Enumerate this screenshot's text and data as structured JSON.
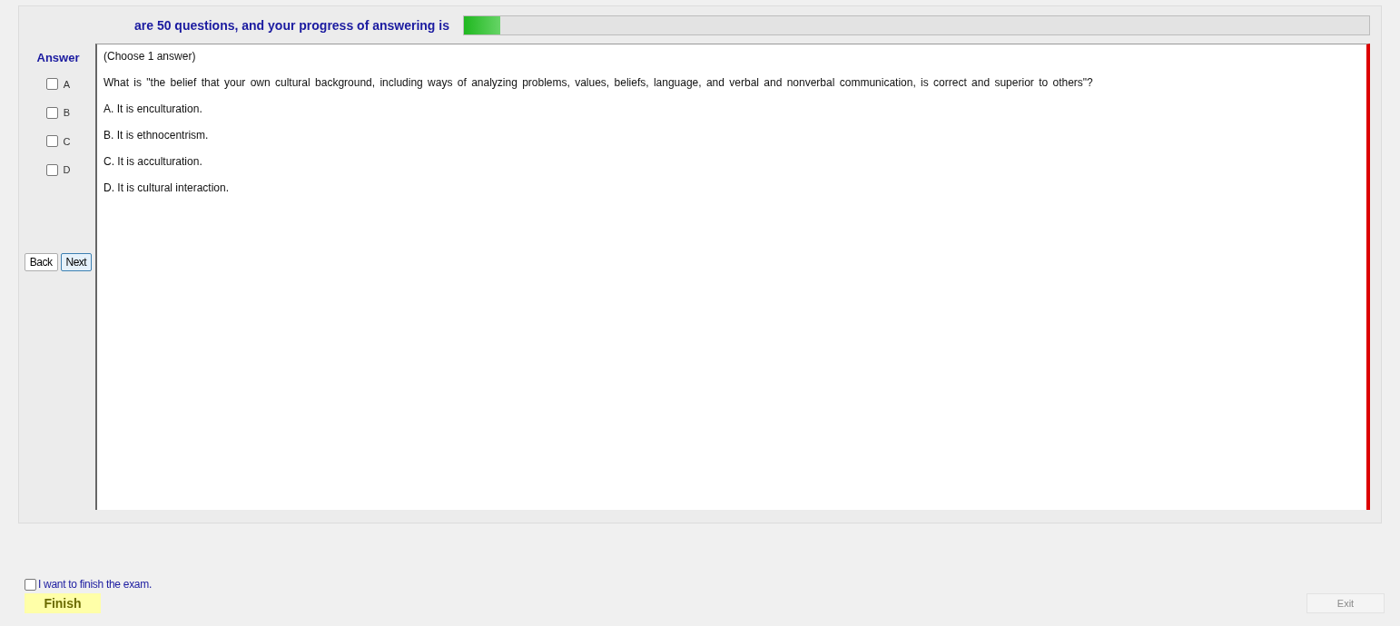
{
  "header": {
    "text": "are 50 questions, and your progress of answering is",
    "progress": {
      "level": 0.04
    }
  },
  "answer_panel": {
    "title": "Answer",
    "options": [
      {
        "label": "A",
        "checked": false
      },
      {
        "label": "B",
        "checked": false
      },
      {
        "label": "C",
        "checked": false
      },
      {
        "label": "D",
        "checked": false
      }
    ],
    "buttons": [
      {
        "label": "Back",
        "kind": "plain"
      },
      {
        "label": "Next",
        "kind": "focused"
      }
    ]
  },
  "question": {
    "instruction": "(Choose 1 answer)",
    "text": "What is \"the belief that your own cultural background, including ways of analyzing problems, values, beliefs, language, and verbal and nonverbal communication, is correct and superior to others\"?",
    "choices": [
      "A.  It is enculturation.",
      "B.  It is ethnocentrism.",
      "C.  It is acculturation.",
      "D.  It is cultural interaction."
    ]
  },
  "footer": {
    "confirm": {
      "label": "I want to finish the exam.",
      "checked": false
    },
    "finish_button": {
      "label": "Finish",
      "disabled": false
    },
    "exit_button": {
      "label": "Exit",
      "disabled": true
    }
  }
}
